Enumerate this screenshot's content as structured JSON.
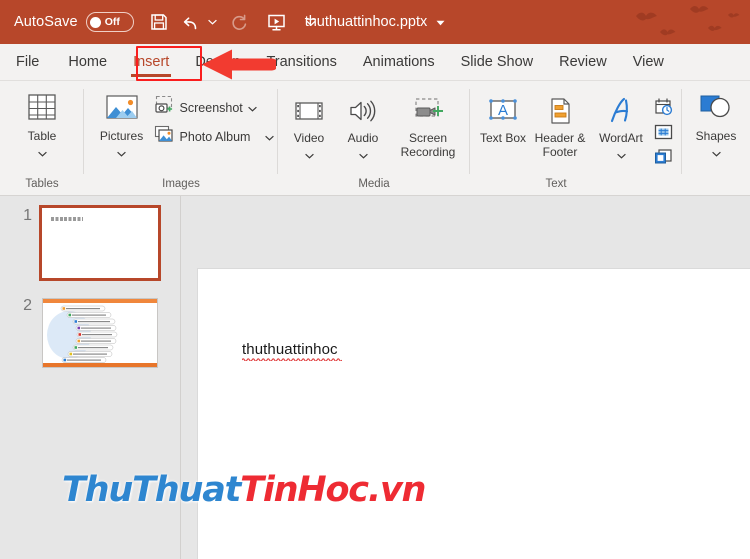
{
  "titlebar": {
    "autosave_label": "AutoSave",
    "autosave_state": "Off",
    "document_title": "thuthuattinhoc.pptx",
    "quick_access": [
      {
        "name": "save-icon",
        "label": "Save"
      },
      {
        "name": "undo-icon",
        "label": "Undo"
      },
      {
        "name": "undo-dropdown-caret-icon",
        "label": "Undo options"
      },
      {
        "name": "redo-icon",
        "label": "Redo"
      },
      {
        "name": "start-slideshow-icon",
        "label": "Start From Beginning"
      },
      {
        "name": "customize-quick-access-caret-icon",
        "label": "Customize Quick Access Toolbar"
      }
    ],
    "title_dropdown_caret": "caret-down-icon",
    "background_color": "#b7472a"
  },
  "tabs": [
    {
      "label": "File",
      "active": false
    },
    {
      "label": "Home",
      "active": false
    },
    {
      "label": "Insert",
      "active": true
    },
    {
      "label": "Design",
      "active": false
    },
    {
      "label": "Transitions",
      "active": false
    },
    {
      "label": "Animations",
      "active": false
    },
    {
      "label": "Slide Show",
      "active": false
    },
    {
      "label": "Review",
      "active": false
    },
    {
      "label": "View",
      "active": false
    }
  ],
  "ribbon": {
    "groups": [
      {
        "label": "Tables",
        "big_buttons": [
          {
            "label": "Table",
            "icon": "table-icon",
            "has_dropdown": true
          }
        ],
        "small_buttons": [],
        "icon_column": []
      },
      {
        "label": "Images",
        "big_buttons": [
          {
            "label": "Pictures",
            "icon": "pictures-icon",
            "has_dropdown": true
          }
        ],
        "small_buttons": [
          {
            "label": "Screenshot",
            "icon": "screenshot-icon",
            "has_dropdown": true
          },
          {
            "label": "Photo Album",
            "icon": "photo-album-icon",
            "has_dropdown": true
          }
        ],
        "icon_column": []
      },
      {
        "label": "Media",
        "big_buttons": [
          {
            "label": "Video",
            "icon": "video-icon",
            "has_dropdown": true
          },
          {
            "label": "Audio",
            "icon": "audio-icon",
            "has_dropdown": true
          },
          {
            "label": "Screen Recording",
            "icon": "screen-recording-icon",
            "has_dropdown": false
          }
        ],
        "small_buttons": [],
        "icon_column": []
      },
      {
        "label": "Text",
        "big_buttons": [
          {
            "label": "Text Box",
            "icon": "text-box-icon",
            "has_dropdown": false
          },
          {
            "label": "Header & Footer",
            "icon": "header-footer-icon",
            "has_dropdown": false
          },
          {
            "label": "WordArt",
            "icon": "wordart-icon",
            "has_dropdown": true
          }
        ],
        "small_buttons": [],
        "icon_column": [
          {
            "name": "date-and-time-icon",
            "label": "Date & Time"
          },
          {
            "name": "slide-number-icon",
            "label": "Slide Number"
          },
          {
            "name": "object-icon",
            "label": "Object"
          }
        ]
      },
      {
        "label": "",
        "big_buttons": [
          {
            "label": "Shapes",
            "icon": "shapes-icon",
            "has_dropdown": true
          }
        ],
        "small_buttons": [],
        "icon_column": []
      }
    ]
  },
  "thumbnails": {
    "slides": [
      {
        "number": "1",
        "selected": true,
        "content_type": "title-text",
        "caption_text": "thuthuattinhoc"
      },
      {
        "number": "2",
        "selected": false,
        "content_type": "smartart-diagram",
        "caption_text": ""
      }
    ]
  },
  "slide_editor": {
    "text_body": "thuthuattinhoc",
    "spellcheck_underline": true
  },
  "annotations": {
    "highlight_rect": {
      "target_tab": "Insert",
      "color": "#fa1e1e"
    },
    "arrow": {
      "direction": "left",
      "color": "#f0392f",
      "points_to": "Insert"
    }
  },
  "watermark": {
    "part1": "ThuThuat",
    "part2": "TinHoc.vn",
    "color1": "#2e86d0",
    "color2": "#ee2b33"
  }
}
